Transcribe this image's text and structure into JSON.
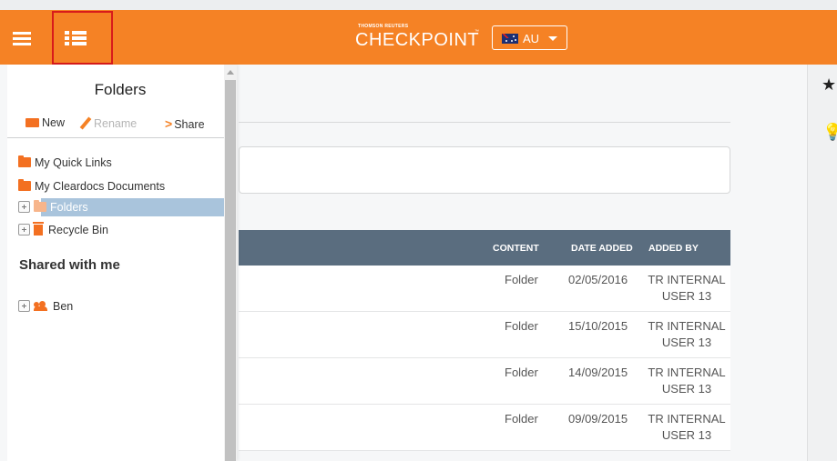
{
  "header": {
    "brand_small": "THOMSON REUTERS",
    "brand_name": "CHECKPOINT",
    "brand_tm": "™",
    "region": "AU",
    "colors": {
      "primary": "#f58225",
      "highlight_border": "#d81b1b"
    }
  },
  "icons": {
    "menu": "hamburger-icon",
    "tree": "folder-tree-icon",
    "favorites": "star-icon",
    "tips": "lightbulb-icon"
  },
  "folders_panel": {
    "title": "Folders",
    "toolbar": {
      "new": "New",
      "rename": "Rename",
      "share": "Share"
    },
    "items": [
      {
        "label": "My Quick Links"
      },
      {
        "label": "My Cleardocs Documents"
      },
      {
        "label": "Folders"
      },
      {
        "label": "Recycle Bin"
      }
    ],
    "shared_title": "Shared with me",
    "shared_items": [
      {
        "label": "Ben"
      }
    ]
  },
  "table": {
    "headers": {
      "content": "CONTENT",
      "date_added": "DATE ADDED",
      "added_by": "ADDED BY"
    },
    "rows": [
      {
        "content": "Folder",
        "date": "02/05/2016",
        "by_1": "TR INTERNAL",
        "by_2": "USER 13"
      },
      {
        "content": "Folder",
        "date": "15/10/2015",
        "by_1": "TR INTERNAL",
        "by_2": "USER 13"
      },
      {
        "content": "Folder",
        "date": "14/09/2015",
        "by_1": "TR INTERNAL",
        "by_2": "USER 13"
      },
      {
        "content": "Folder",
        "date": "09/09/2015",
        "by_1": "TR INTERNAL",
        "by_2": "USER 13"
      }
    ]
  }
}
